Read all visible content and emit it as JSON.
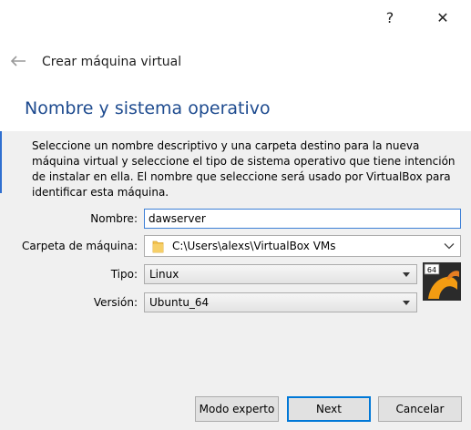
{
  "titlebar": {
    "help_label": "?",
    "close_label": "✕"
  },
  "wizard": {
    "title": "Crear máquina virtual",
    "page_title": "Nombre y sistema operativo",
    "description": "Seleccione un nombre descriptivo y una carpeta destino para la nueva máquina virtual y seleccione el tipo de sistema operativo que tiene intención de instalar en ella. El nombre que seleccione será usado por VirtualBox para identificar esta máquina."
  },
  "form": {
    "name_label": "Nombre:",
    "name_value": "dawserver",
    "folder_label": "Carpeta de máquina:",
    "folder_value": "C:\\Users\\alexs\\VirtualBox VMs",
    "type_label": "Tipo:",
    "type_value": "Linux",
    "version_label": "Versión:",
    "version_value": "Ubuntu_64",
    "os_icon_badge": "64"
  },
  "buttons": {
    "expert": "Modo experto",
    "next": "Next",
    "cancel": "Cancelar"
  },
  "colors": {
    "page_title": "#1e4b8f",
    "focus_border": "#3c7fd6",
    "folder_yellow": "#f2c14e",
    "os_icon_orange": "#f39c12"
  }
}
